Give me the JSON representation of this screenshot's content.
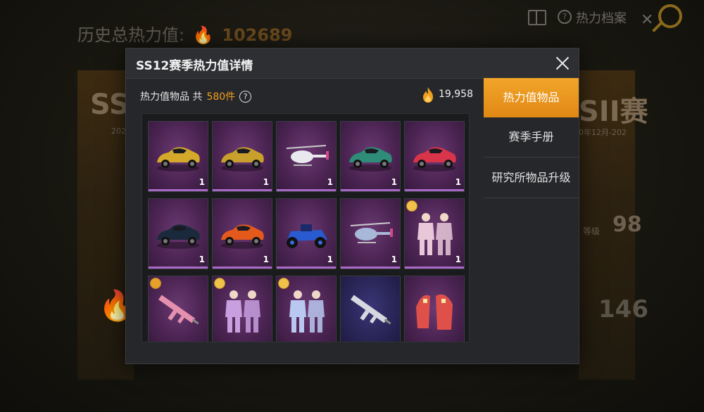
{
  "background": {
    "history_label": "历史总热力值:",
    "history_value": "102689",
    "archive_label": "热力档案",
    "left_card_label": "SS",
    "left_card_sub": "202",
    "right_card_label": "SII赛",
    "right_card_sub": "0年12月-202",
    "right_card_level_label": "等级",
    "right_card_level_value": "98",
    "right_card_count": "146"
  },
  "modal": {
    "title": "SS12赛季热力值详情",
    "count_label": "热力值物品 共",
    "count_value": "580件",
    "points_value": "19,958"
  },
  "tabs": [
    {
      "label": "热力值物品",
      "active": true
    },
    {
      "label": "赛季手册",
      "active": false
    },
    {
      "label": "研究所物品升级",
      "active": false
    }
  ],
  "items": [
    {
      "name": "gold-sports-car",
      "art": "car",
      "color": "#d4a82a",
      "qty": "1"
    },
    {
      "name": "gold-sports-car-2",
      "art": "car",
      "color": "#c9a02c",
      "qty": "1"
    },
    {
      "name": "helicopter-white",
      "art": "heli",
      "color": "#e8e8ee",
      "qty": "1"
    },
    {
      "name": "green-sports-car",
      "art": "car",
      "color": "#2e8c78",
      "qty": "1"
    },
    {
      "name": "red-sports-car",
      "art": "car",
      "color": "#d8344a",
      "qty": "1"
    },
    {
      "name": "dark-blue-suv",
      "art": "car",
      "color": "#1a2a3c",
      "qty": "1"
    },
    {
      "name": "orange-sports-car",
      "art": "car",
      "color": "#e45a1c",
      "qty": "1"
    },
    {
      "name": "blue-kart",
      "art": "kart",
      "color": "#2a5ad0",
      "qty": "1"
    },
    {
      "name": "helicopter-blue",
      "art": "heli",
      "color": "#a8b8d8",
      "qty": "1"
    },
    {
      "name": "outfit-set-pink",
      "art": "outfit",
      "color": "#e8c8d8",
      "qty": "1",
      "badge": true
    },
    {
      "name": "pink-rifle",
      "art": "rifle",
      "color": "#e690b0",
      "qty": "",
      "badge": true,
      "badge_color": "orange"
    },
    {
      "name": "outfit-set-purple",
      "art": "outfit",
      "color": "#c8a0e0",
      "qty": "",
      "badge": true
    },
    {
      "name": "outfit-set-blue-white",
      "art": "outfit",
      "color": "#b8c8f0",
      "qty": "",
      "badge": true
    },
    {
      "name": "white-rifle",
      "art": "rifle",
      "color": "#d8d8e0",
      "qty": "",
      "bg": "blue"
    },
    {
      "name": "red-hood-outfit",
      "art": "hood",
      "color": "#e0504a",
      "qty": ""
    }
  ],
  "colors": {
    "accent": "#f2a52a",
    "count_highlight": "#f0a020",
    "item_rarity_bar": "#a868c6"
  }
}
